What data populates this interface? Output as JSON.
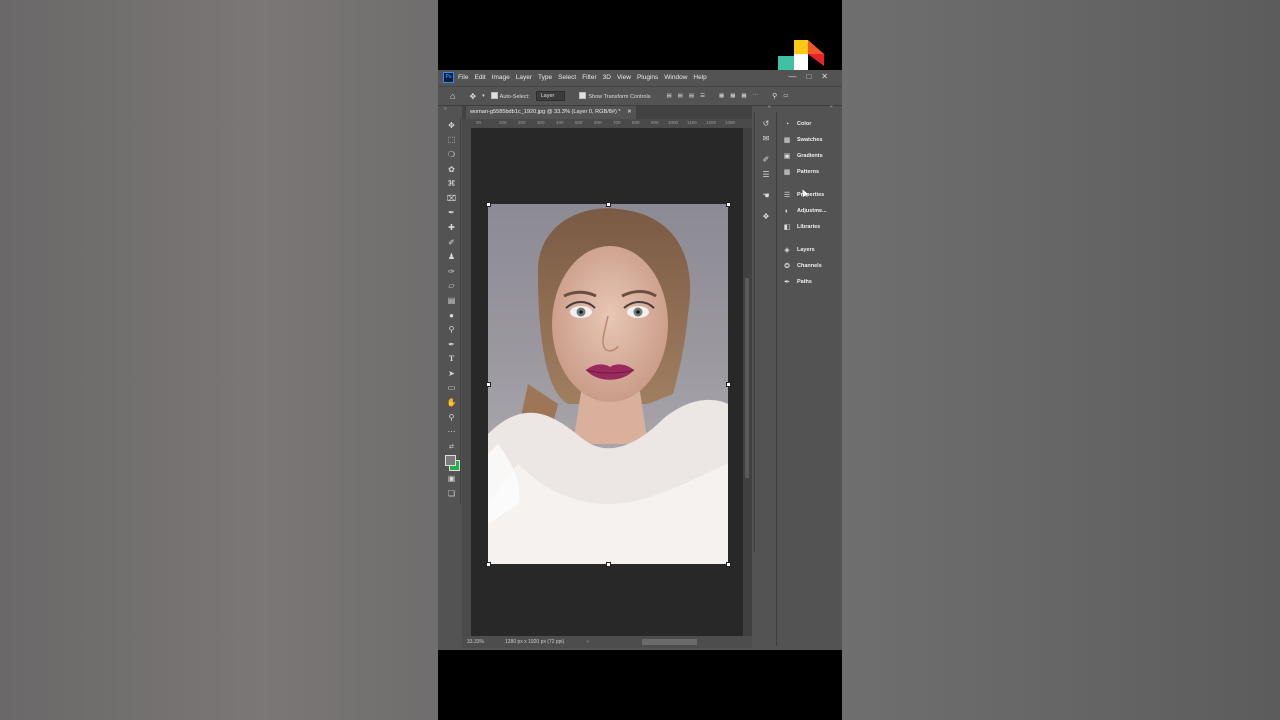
{
  "menu": [
    "File",
    "Edit",
    "Image",
    "Layer",
    "Type",
    "Select",
    "Filter",
    "3D",
    "View",
    "Plugins",
    "Window",
    "Help"
  ],
  "app_icon": "Ps",
  "options": {
    "auto_select_label": "Auto-Select:",
    "auto_select_value": "Layer",
    "show_transform_label": "Show Transform Controls"
  },
  "document": {
    "tab_title": "woman-g5585bdb1c_1920.jpg @ 33.3% (Layer 0, RGB/8#) *",
    "zoom": "33.33%",
    "dimensions": "1280 px x 1920 px (72 ppi)"
  },
  "ruler_ticks": [
    "00",
    "100",
    "200",
    "300",
    "400",
    "500",
    "600",
    "700",
    "800",
    "900",
    "1000",
    "1100",
    "1200",
    "1300"
  ],
  "panels": [
    {
      "label": "Color",
      "icon": "color-wheel-icon"
    },
    {
      "label": "Swatches",
      "icon": "grid-icon"
    },
    {
      "label": "Gradients",
      "icon": "gradient-icon"
    },
    {
      "label": "Patterns",
      "icon": "pattern-icon"
    },
    {
      "label": "Properties",
      "icon": "sliders-icon"
    },
    {
      "label": "Adjustme...",
      "icon": "adjust-icon"
    },
    {
      "label": "Libraries",
      "icon": "library-icon"
    },
    {
      "label": "Layers",
      "icon": "layers-icon"
    },
    {
      "label": "Channels",
      "icon": "channels-icon"
    },
    {
      "label": "Paths",
      "icon": "pen-path-icon"
    }
  ],
  "colors": {
    "foreground": "#7a7a7a",
    "background": "#22b14c",
    "ui_panel": "#535353",
    "canvas": "#282828"
  }
}
